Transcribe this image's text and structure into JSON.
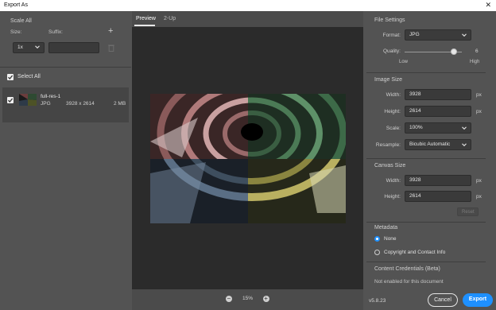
{
  "window": {
    "title": "Export As",
    "close": "✕"
  },
  "left": {
    "scale_all": "Scale All",
    "size_label": "Size:",
    "suffix_label": "Suffix:",
    "size_value": "1x",
    "suffix_placeholder": "",
    "add_symbol": "+",
    "select_all": "Select All",
    "asset": {
      "name": "full-res-1",
      "format": "JPG",
      "dimensions": "3928 x 2614",
      "filesize": "2 MB"
    }
  },
  "center": {
    "tabs": [
      {
        "label": "Preview"
      },
      {
        "label": "2-Up"
      }
    ],
    "zoom": "15%",
    "zoom_out": "−",
    "zoom_in": "+"
  },
  "right": {
    "file_settings": {
      "title": "File Settings",
      "format_label": "Format:",
      "format_value": "JPG",
      "quality_label": "Quality:",
      "quality_value": "6",
      "quality_fraction": 0.86,
      "low": "Low",
      "high": "High"
    },
    "image_size": {
      "title": "Image Size",
      "width_label": "Width:",
      "width_value": "3928",
      "height_label": "Height:",
      "height_value": "2614",
      "unit": "px",
      "scale_label": "Scale:",
      "scale_value": "100%",
      "resample_label": "Resample:",
      "resample_value": "Bicubic Automatic"
    },
    "canvas_size": {
      "title": "Canvas Size",
      "width_label": "Width:",
      "width_value": "3928",
      "height_label": "Height:",
      "height_value": "2614",
      "unit": "px",
      "reset": "Reset"
    },
    "metadata": {
      "title": "Metadata",
      "none": "None",
      "copyright": "Copyright and Contact Info"
    },
    "credentials": {
      "title": "Content Credentials (Beta)",
      "note": "Not enabled for this document"
    }
  },
  "footer": {
    "version": "v5.8.23",
    "cancel": "Cancel",
    "export": "Export"
  },
  "colors": {
    "accent": "#1e90ff",
    "panel": "#535353",
    "preview_bg": "#2b2b2b"
  }
}
